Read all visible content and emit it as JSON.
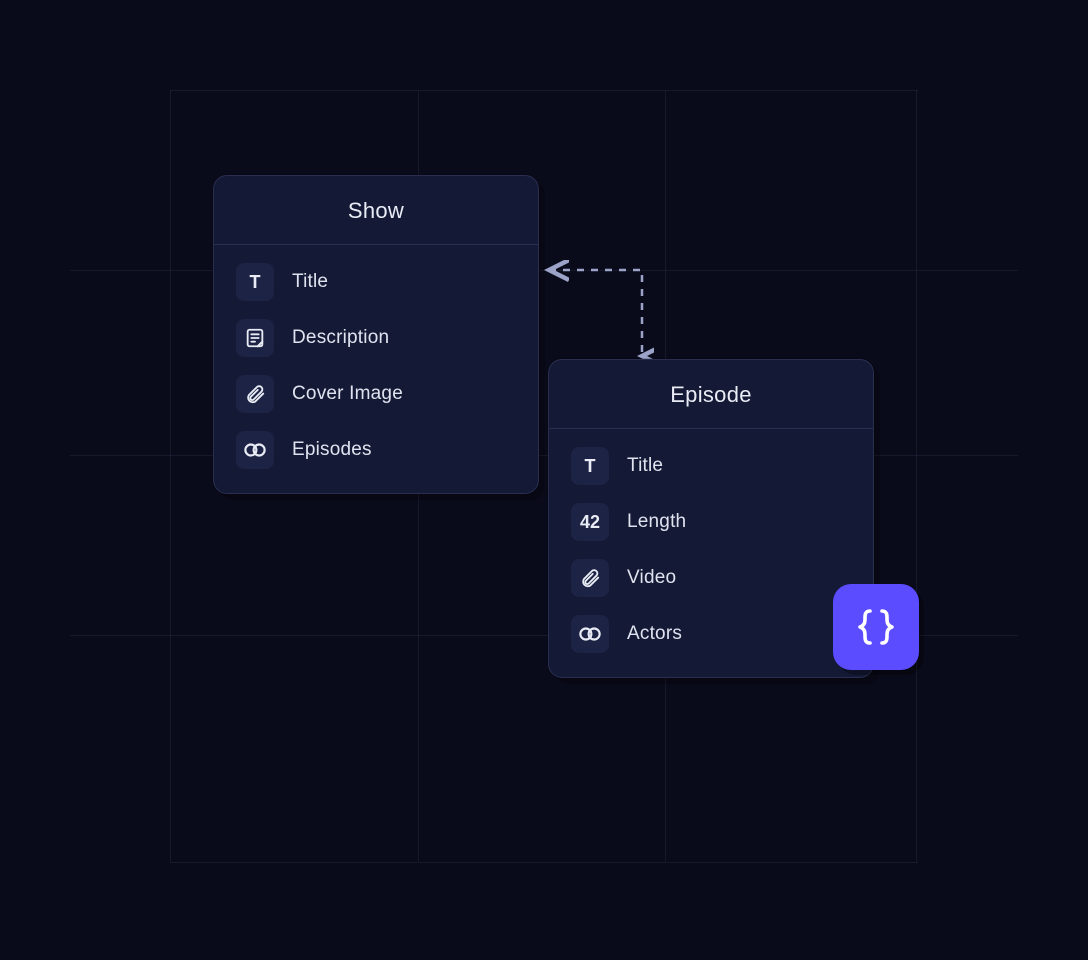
{
  "entities": {
    "show": {
      "title": "Show",
      "fields": [
        {
          "icon": "text",
          "label": "Title"
        },
        {
          "icon": "description",
          "label": "Description"
        },
        {
          "icon": "attachment",
          "label": "Cover Image"
        },
        {
          "icon": "link",
          "label": "Episodes"
        }
      ]
    },
    "episode": {
      "title": "Episode",
      "fields": [
        {
          "icon": "text",
          "label": "Title"
        },
        {
          "icon": "number",
          "number_glyph": "42",
          "label": "Length"
        },
        {
          "icon": "attachment",
          "label": "Video"
        },
        {
          "icon": "link",
          "label": "Actors"
        }
      ]
    }
  },
  "connector": {
    "type": "bidirectional-dashed"
  },
  "badge": {
    "type": "json-braces"
  },
  "colors": {
    "background": "#0a0b1a",
    "card_bg": "#141935",
    "card_border": "#2a2f52",
    "icon_bg": "#1c2344",
    "text": "#e9ecf5",
    "accent": "#5b4cff",
    "grid": "rgba(60,65,100,0.25)",
    "connector": "#9ba3c9"
  }
}
